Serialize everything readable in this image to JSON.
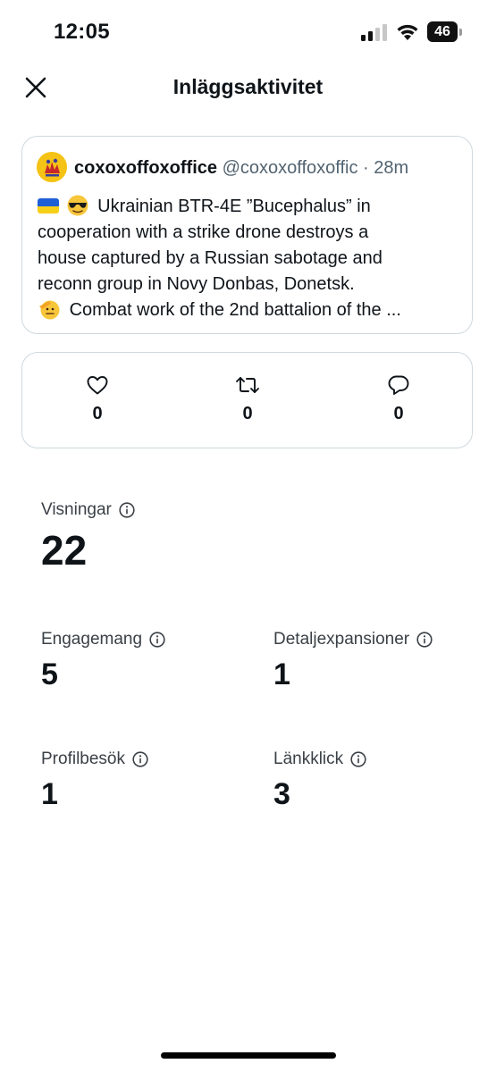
{
  "status_bar": {
    "time": "12:05",
    "battery": "46",
    "icons": [
      "signal-icon",
      "wifi-icon",
      "battery-icon"
    ]
  },
  "header": {
    "title": "Inläggsaktivitet",
    "close_icon": "close-icon"
  },
  "tweet": {
    "author_name": "coxoxoffoxoffice",
    "author_handle": "@coxoxoffoxoffic",
    "separator": "·",
    "time": "28m",
    "lines": [
      "Ukrainian BTR-4E ”Bucephalus” in",
      "cooperation with a strike drone destroys a",
      "house captured by a Russian sabotage and",
      "reconn group in Novy Donbas, Donetsk.",
      "Combat work of the 2nd battalion of the ..."
    ],
    "emojis": [
      "ukraine-flag-emoji",
      "sunglasses-emoji",
      "saluting-face-emoji"
    ]
  },
  "engagement": {
    "likes": "0",
    "reposts": "0",
    "replies": "0",
    "icons": [
      "heart-icon",
      "repost-icon",
      "reply-icon"
    ]
  },
  "metrics": {
    "views": {
      "label": "Visningar",
      "value": "22"
    },
    "engagements": {
      "label": "Engagemang",
      "value": "5"
    },
    "detail_expands": {
      "label": "Detaljexpansioner",
      "value": "1"
    },
    "profile_visits": {
      "label": "Profilbesök",
      "value": "1"
    },
    "link_clicks": {
      "label": "Länkklick",
      "value": "3"
    }
  },
  "colors": {
    "text_primary": "#0f1419",
    "text_secondary": "#536471",
    "border": "#cfd9de",
    "flag_blue": "#1f5fd6",
    "flag_yellow": "#f6cf18"
  }
}
